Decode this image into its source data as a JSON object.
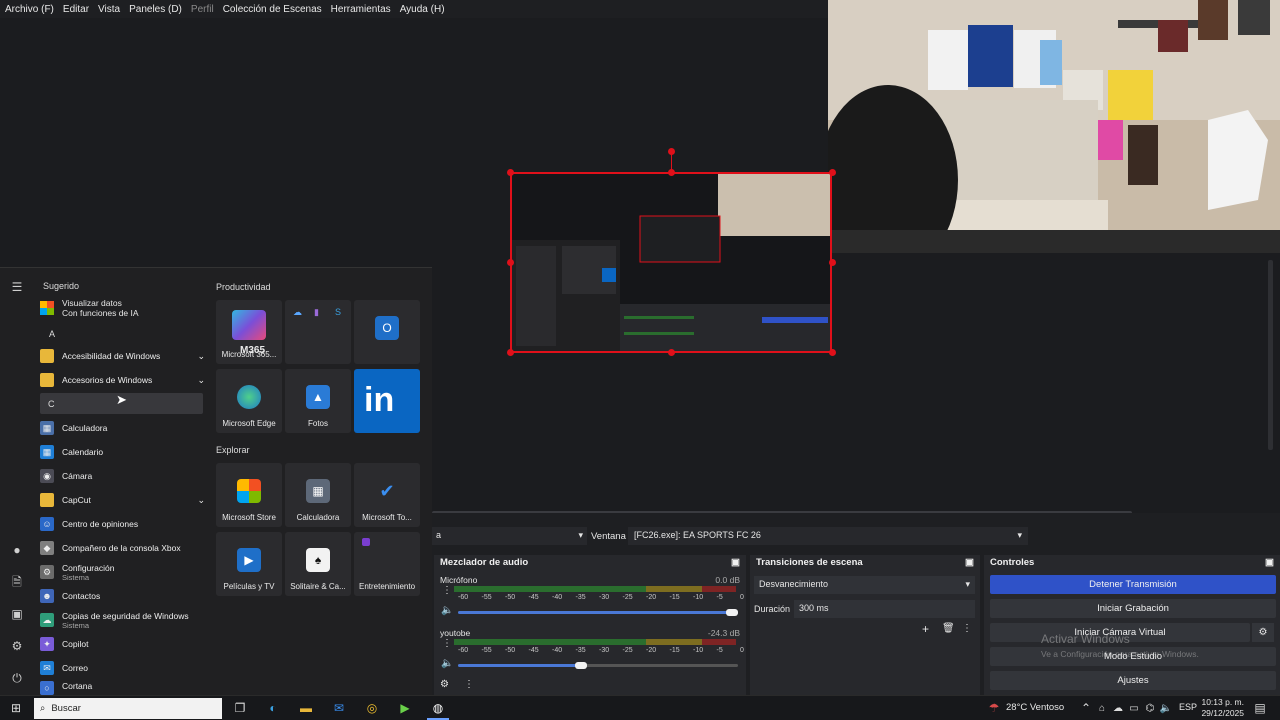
{
  "menubar": {
    "items": [
      "Archivo (F)",
      "Editar",
      "Vista",
      "Paneles (D)",
      "Perfil",
      "Colección de Escenas",
      "Herramientas",
      "Ayuda (H)"
    ]
  },
  "start_menu": {
    "suggested_label": "Sugerido",
    "suggested_item": {
      "title": "Visualizar datos",
      "subtitle": "Con funciones de IA"
    },
    "letter_a": "A",
    "letter_c": "C",
    "apps": [
      {
        "label": "Accesibilidad de Windows",
        "sub": "",
        "icon": "folder-icon",
        "color": "#e8b73a",
        "chevron": true
      },
      {
        "label": "Accesorios de Windows",
        "sub": "",
        "icon": "folder-icon",
        "color": "#e8b73a",
        "chevron": true
      },
      {
        "label": "Calculadora",
        "sub": "",
        "icon": "calculator-icon",
        "color": "#4a6fa8",
        "chevron": false
      },
      {
        "label": "Calendario",
        "sub": "",
        "icon": "calendar-icon",
        "color": "#1f7fd6",
        "chevron": false
      },
      {
        "label": "Cámara",
        "sub": "",
        "icon": "camera-icon",
        "color": "#4b4b55",
        "chevron": false
      },
      {
        "label": "CapCut",
        "sub": "",
        "icon": "folder-icon",
        "color": "#e8b73a",
        "chevron": true
      },
      {
        "label": "Centro de opiniones",
        "sub": "",
        "icon": "feedback-icon",
        "color": "#2a68c8",
        "chevron": false
      },
      {
        "label": "Compañero de la consola Xbox",
        "sub": "",
        "icon": "xbox-icon",
        "color": "#7f7f7f",
        "chevron": false
      },
      {
        "label": "Configuración",
        "sub": "Sistema",
        "icon": "gear-icon",
        "color": "#6b6b6b",
        "chevron": false
      },
      {
        "label": "Contactos",
        "sub": "",
        "icon": "contacts-icon",
        "color": "#3f66b8",
        "chevron": false
      },
      {
        "label": "Copias de seguridad de Windows",
        "sub": "Sistema",
        "icon": "backup-icon",
        "color": "#2f9d7a",
        "chevron": false
      },
      {
        "label": "Copilot",
        "sub": "",
        "icon": "copilot-icon",
        "color": "#7a5cd8",
        "chevron": false
      },
      {
        "label": "Correo",
        "sub": "",
        "icon": "mail-icon",
        "color": "#1f7fd6",
        "chevron": false
      },
      {
        "label": "Cortana",
        "sub": "",
        "icon": "cortana-icon",
        "color": "#3a6fd0",
        "chevron": false
      }
    ],
    "productividad_label": "Productividad",
    "explorar_label": "Explorar",
    "tiles_productividad": [
      {
        "label": "Microsoft 365...",
        "badge": "M365",
        "icon": "m365-icon",
        "color": "#2a7bd6"
      },
      {
        "label": "",
        "badge": "",
        "icon": "office-group-icon",
        "color": "#2b2b2e"
      },
      {
        "label": "",
        "badge": "",
        "icon": "outlook-icon",
        "color": "#2b2b2e"
      },
      {
        "label": "Microsoft Edge",
        "badge": "",
        "icon": "edge-icon",
        "color": "#1e7ac8"
      },
      {
        "label": "Fotos",
        "badge": "",
        "icon": "photos-icon",
        "color": "#2a7bd6"
      },
      {
        "label": "",
        "badge": "in",
        "icon": "linkedin-icon",
        "color": "#0a66c2"
      }
    ],
    "tiles_explorar": [
      {
        "label": "Microsoft Store",
        "icon": "store-icon",
        "color": "#2b2b2e"
      },
      {
        "label": "Calculadora",
        "icon": "calculator-icon",
        "color": "#2b2b2e"
      },
      {
        "label": "Microsoft To...",
        "icon": "todo-icon",
        "color": "#2b2b2e"
      },
      {
        "label": "Películas y TV",
        "icon": "movies-icon",
        "color": "#2b2b2e"
      },
      {
        "label": "Solitaire & Ca...",
        "icon": "solitaire-icon",
        "color": "#2b2b2e"
      },
      {
        "label": "Entretenimiento",
        "icon": "entertainment-icon",
        "color": "#2b2b2e"
      }
    ]
  },
  "source_bar": {
    "left_value": "a",
    "window_label": "Ventana",
    "window_value": "[FC26.exe]: EA SPORTS FC 26"
  },
  "audio_mixer": {
    "title": "Mezclador de audio",
    "scale": [
      "-60",
      "-55",
      "-50",
      "-45",
      "-40",
      "-35",
      "-30",
      "-25",
      "-20",
      "-15",
      "-10",
      "-5",
      "0"
    ],
    "channels": [
      {
        "name": "Micrófono",
        "db": "0.0 dB",
        "level": 0.98
      },
      {
        "name": "youtobe",
        "db": "-24.3 dB",
        "level": 0.44
      }
    ]
  },
  "transitions": {
    "title": "Transiciones de escena",
    "selected": "Desvanecimiento",
    "duration_label": "Duración",
    "duration_value": "300 ms"
  },
  "controls": {
    "title": "Controles",
    "buttons": [
      "Detener Transmisión",
      "Iniciar Grabación",
      "Iniciar Cámara Virtual",
      "Modo Estudio",
      "Ajustes"
    ],
    "watermark_title": "Activar Windows",
    "watermark_sub": "Ve a Configuración para activar Windows."
  },
  "taskbar": {
    "search_placeholder": "Buscar",
    "weather": "28°C  Ventoso",
    "language": "ESP",
    "time": "10:13 p. m.",
    "date": "29/12/2025"
  },
  "colors": {
    "accent_blue": "#2f52c8",
    "selection_red": "#e0101a"
  }
}
